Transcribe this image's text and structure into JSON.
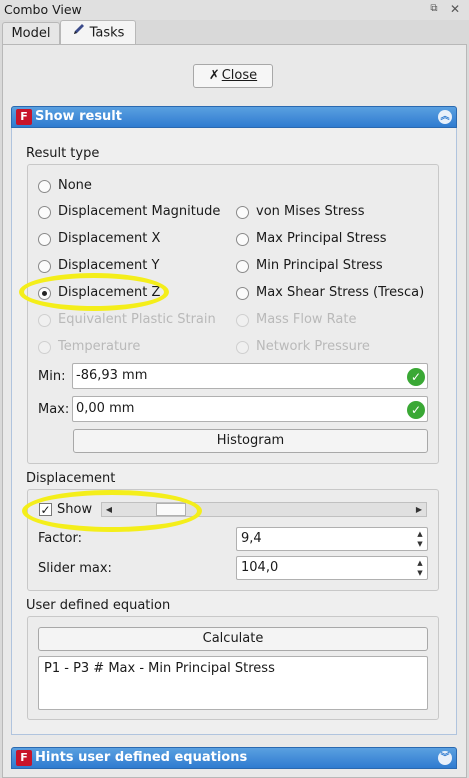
{
  "window": {
    "title": "Combo View"
  },
  "tabs": [
    {
      "label": "Model"
    },
    {
      "label": "Tasks"
    }
  ],
  "close_button": {
    "label": "Close"
  },
  "show_result": {
    "title": "Show result",
    "result_type": {
      "title": "Result type",
      "left": [
        "None",
        "Displacement Magnitude",
        "Displacement X",
        "Displacement Y",
        "Displacement Z",
        "Equivalent Plastic Strain",
        "Temperature"
      ],
      "right": [
        "von Mises Stress",
        "Max Principal Stress",
        "Min Principal Stress",
        "Max Shear Stress (Tresca)",
        "Mass Flow Rate",
        "Network Pressure"
      ],
      "selected": "Displacement Z"
    },
    "min": {
      "label": "Min:",
      "value": "-86,93 mm"
    },
    "max": {
      "label": "Max:",
      "value": "0,00 mm"
    },
    "histogram_label": "Histogram",
    "displacement": {
      "title": "Displacement",
      "show_label": "Show",
      "show_checked": true,
      "slider_fraction": 0.15,
      "factor": {
        "label": "Factor:",
        "value": "9,4"
      },
      "slider_max": {
        "label": "Slider max:",
        "value": "104,0"
      }
    },
    "user_equation": {
      "title": "User defined equation",
      "calculate_label": "Calculate",
      "equation": "P1 - P3 # Max - Min Principal Stress"
    }
  },
  "hints": {
    "title": "Hints user defined equations"
  },
  "colors": {
    "header_blue": "#2f7bd0",
    "highlight_yellow": "#f4ee1a",
    "ok_green": "#3aa835"
  }
}
